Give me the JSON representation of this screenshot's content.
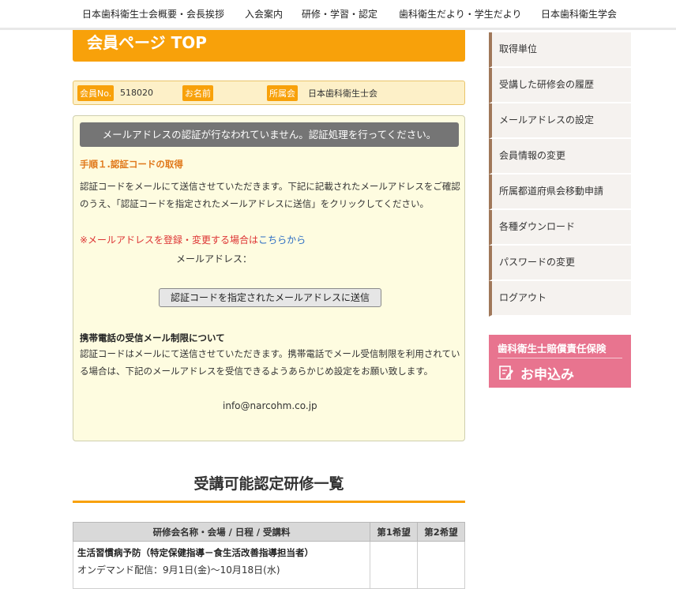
{
  "topnav": {
    "items": [
      "日本歯科衛生士会概要・会長挨拶",
      "入会案内",
      "研修・学習・認定",
      "歯科衛生だより・学生だより",
      "日本歯科衛生学会"
    ]
  },
  "page": {
    "title": "会員ページ TOP"
  },
  "member": {
    "no_label": "会員No.",
    "no_value": "518020",
    "name_label": "お名前",
    "name_value": "",
    "affiliation_label": "所属会",
    "affiliation_value": "日本歯科衛生士会"
  },
  "notice": {
    "alert": "メールアドレスの認証が行なわれていません。認証処理を行ってください。",
    "step_title": "手順１.認証コードの取得",
    "step_text": "認証コードをメールにて送信させていただきます。下記に記載されたメールアドレスをご確認のうえ、「認証コードを指定されたメールアドレスに送信」をクリックしてください。",
    "register_text": "※メールアドレスを登録・変更する場合は",
    "register_link": "こちらから",
    "email_label": "メールアドレス：",
    "send_button": "認証コードを指定されたメールアドレスに送信",
    "mobile_title": "携帯電話の受信メール制限について",
    "mobile_text": "認証コードはメールにて送信させていただきます。携帯電話でメール受信制限を利用されている場合は、下記のメールアドレスを受信できるようあらかじめ設定をお願い致します。",
    "sender_email": "info@narcohm.co.jp"
  },
  "courses": {
    "title": "受講可能認定研修一覧",
    "headers": [
      "研修会名称・会場 / 日程 / 受講料",
      "第1希望",
      "第2希望"
    ],
    "rows": [
      {
        "name": "生活習慣病予防（特定保健指導－食生活改善指導担当者）",
        "date": "オンデマンド配信：9月1日(金)～10月18日(水)"
      }
    ]
  },
  "sidebar": {
    "items": [
      "取得単位",
      "受講した研修会の履歴",
      "メールアドレスの設定",
      "会員情報の変更",
      "所属都道府県会移動申請",
      "各種ダウンロード",
      "パスワードの変更",
      "ログアウト"
    ]
  },
  "banner": {
    "title": "歯科衛生士賠償責任保険",
    "cta": "お申込み",
    "color": "#e8748f"
  },
  "colors": {
    "accent": "#f8a10a",
    "sidebar_border": "#a0785a",
    "notice_bg": "#fefce0",
    "link": "#2a6bc3",
    "warning": "#d33"
  }
}
